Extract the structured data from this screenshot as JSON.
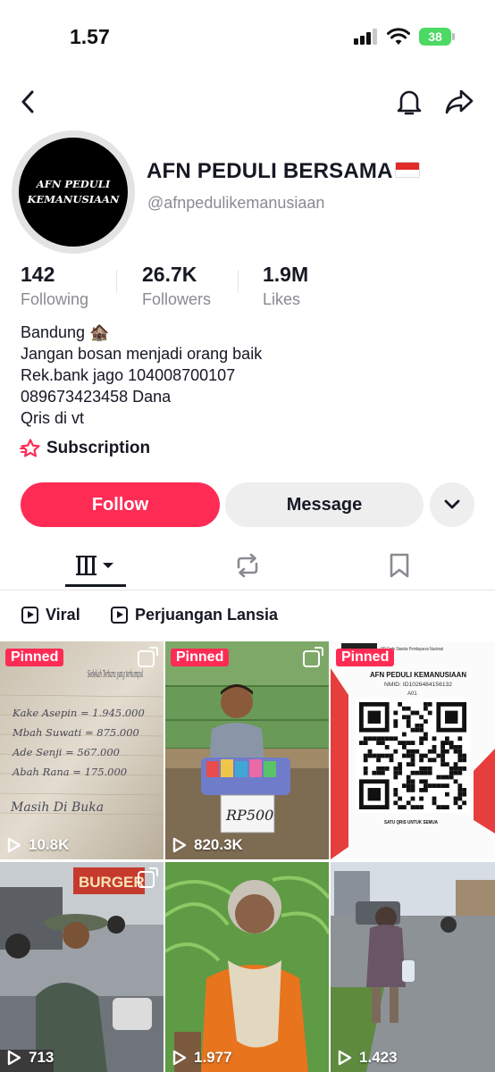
{
  "status_bar": {
    "time": "1.57",
    "battery": "38"
  },
  "nav": {
    "back_icon": "chevron-left-icon",
    "bell_icon": "bell-icon",
    "share_icon": "share-arrow-icon"
  },
  "profile": {
    "avatar_text_line1": "AFN PEDULI",
    "avatar_text_line2": "KEMANUSIAAN",
    "display_name": "AFN PEDULI BERSAMA",
    "username": "@afnpedulikemanusiaan"
  },
  "stats": [
    {
      "value": "142",
      "label": "Following"
    },
    {
      "value": "26.7K",
      "label": "Followers"
    },
    {
      "value": "1.9M",
      "label": "Likes"
    }
  ],
  "bio": {
    "line1": "Bandung 🏚️",
    "line2": "Jangan bosan menjadi orang baik",
    "line3": "Rek.bank jago 104008700107",
    "line4": "089673423458 Dana",
    "line5": "Qris di vt"
  },
  "subscription_label": "Subscription",
  "buttons": {
    "follow": "Follow",
    "message": "Message"
  },
  "tabs": {
    "videos_icon": "grid-bars-icon",
    "reposts_icon": "repost-icon",
    "saved_icon": "bookmark-icon"
  },
  "playlists": [
    {
      "label": "Viral"
    },
    {
      "label": "Perjuangan Lansia"
    }
  ],
  "videos": [
    {
      "pinned_label": "Pinned",
      "views": "10.8K",
      "multi": true
    },
    {
      "pinned_label": "Pinned",
      "views": "820.3K",
      "multi": true
    },
    {
      "pinned_label": "Pinned",
      "views": "",
      "multi": false
    },
    {
      "pinned_label": "",
      "views": "713",
      "multi": true
    },
    {
      "pinned_label": "",
      "views": "1.977",
      "multi": false
    },
    {
      "pinned_label": "",
      "views": "1.423",
      "multi": false
    }
  ],
  "tile_text": {
    "note_title": "Sedekah Terbaru yang terkumpul",
    "note_l1": "Kake Asepin = 1.945.000",
    "note_l2": "Mbah Suwati = 875.000",
    "note_l3": "Ade Senji = 567.000",
    "note_l4": "Abah Rana = 175.000",
    "note_l5": "Masih Di Buka",
    "price_sign": "RP500",
    "qris_header": "QR Code Standar Pembayaran Nasional",
    "qris_name": "AFN PEDULI KEMANUSIAAN",
    "qris_nmid": "NMID: ID1026484156132",
    "qris_code": "A01",
    "qris_footer": "SATU QRIS UNTUK SEMUA",
    "shop_sign": "BURGER"
  },
  "colors": {
    "accent": "#fe2c55",
    "text": "#161823",
    "muted": "#8a8b91",
    "battery": "#4cd964"
  }
}
